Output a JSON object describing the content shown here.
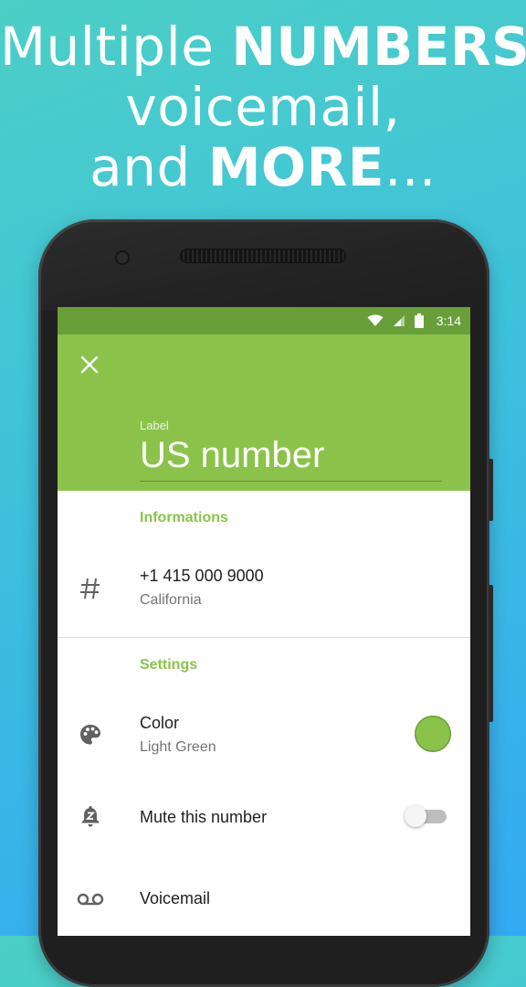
{
  "headline": {
    "line1_normal": "Multiple ",
    "line1_bold": "NUMBERS",
    "line1_tail": ",",
    "line2": "voicemail,",
    "line3_normal": "and ",
    "line3_bold": "MORE",
    "line3_tail": "..."
  },
  "status_bar": {
    "time": "3:14",
    "icons": [
      "wifi-icon",
      "signal-icon",
      "battery-icon"
    ],
    "color": "#689f38"
  },
  "header": {
    "close_icon": "close-icon",
    "label_caption": "Label",
    "label_value": "US number",
    "color": "#8bc34a"
  },
  "informations": {
    "title": "Informations",
    "number": {
      "icon": "hash-icon",
      "primary": "+1 415 000 9000",
      "secondary": "California"
    }
  },
  "settings": {
    "title": "Settings",
    "color": {
      "icon": "palette-icon",
      "primary": "Color",
      "secondary": "Light Green",
      "swatch": "#8bc34a"
    },
    "mute": {
      "icon": "snooze-bell-icon",
      "primary": "Mute this number",
      "enabled": false
    },
    "voicemail": {
      "icon": "voicemail-icon",
      "primary": "Voicemail"
    }
  }
}
